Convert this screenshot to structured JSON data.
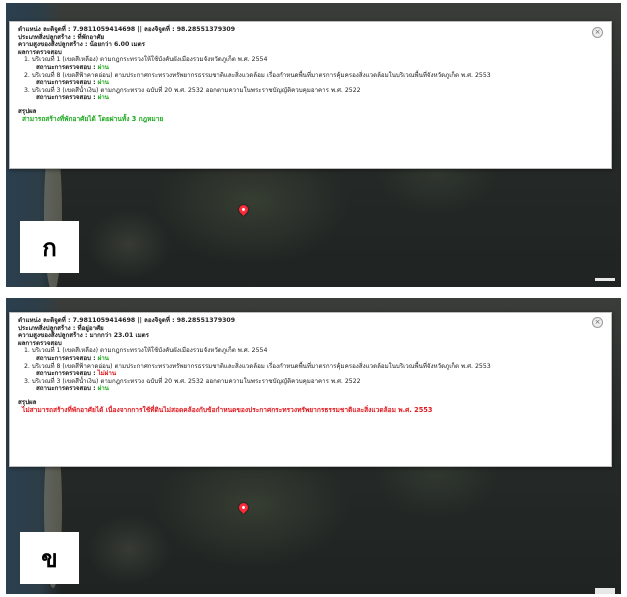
{
  "panels": [
    {
      "label": "ก",
      "location": {
        "lat_label": "ตำแหน่ง   ละติจูดที่ : 7.9811059414698  ||  ลองจิจูดที่ : 98.28551379309"
      },
      "building_type": "ประเภทสิ่งปลูกสร้าง : ที่พักอาศัย",
      "building_height": "ความสูงของสิ่งปลูกสร้าง : น้อยกว่า 6.00 เมตร",
      "results_heading": "ผลการตรวจสอบ",
      "checks": [
        {
          "text": "1. บริเวณที่ 1 (เขตสีเหลือง) ตามกฎกระทรวงให้ใช้บังคับผังเมืองรวมจังหวัดภูเก็ต พ.ศ. 2554",
          "status_label": "สถานะการตรวจสอบ :",
          "status": "ผ่าน"
        },
        {
          "text": "2. บริเวณที่ 8 (เขตสีฟ้าคาดอ่อน) ตามประกาศกระทรวงทรัพยากรธรรมชาติและสิ่งแวดล้อม เรื่องกำหนดพื้นที่มาตรการคุ้มครองสิ่งแวดล้อมในบริเวณพื้นที่จังหวัดภูเก็ต พ.ศ. 2553",
          "status_label": "สถานะการตรวจสอบ :",
          "status": "ผ่าน"
        },
        {
          "text": "3. บริเวณที่ 3 (เขตสีน้ำเงิน) ตามกฎกระทรวง ฉบับที่ 20 พ.ศ. 2532 ออกตามความในพระราชบัญญัติควบคุมอาคาร พ.ศ. 2522",
          "status_label": "สถานะการตรวจสอบ :",
          "status": "ผ่าน"
        }
      ],
      "summary_heading": "สรุปผล",
      "summary": "สามารถสร้างที่พักอาศัยได้ โดยผ่านทั้ง 3 กฎหมาย"
    },
    {
      "label": "ข",
      "location": {
        "lat_label": "ตำแหน่ง   ละติจูดที่ : 7.9811059414698  ||  ลองจิจูดที่ : 98.28551379309"
      },
      "building_type": "ประเภทสิ่งปลูกสร้าง : ที่อยู่อาศัย",
      "building_height": "ความสูงของสิ่งปลูกสร้าง : มากกว่า 23.01 เมตร",
      "results_heading": "ผลการตรวจสอบ",
      "checks": [
        {
          "text": "1. บริเวณที่ 1 (เขตสีเหลือง) ตามกฎกระทรวงให้ใช้บังคับผังเมืองรวมจังหวัดภูเก็ต พ.ศ. 2554",
          "status_label": "สถานะการตรวจสอบ :",
          "status": "ผ่าน"
        },
        {
          "text": "2. บริเวณที่ 8 (เขตสีฟ้าคาดอ่อน) ตามประกาศกระทรวงทรัพยากรธรรมชาติและสิ่งแวดล้อม เรื่องกำหนดพื้นที่มาตรการคุ้มครองสิ่งแวดล้อมในบริเวณพื้นที่จังหวัดภูเก็ต พ.ศ. 2553",
          "status_label": "สถานะการตรวจสอบ :",
          "status": "ไม่ผ่าน"
        },
        {
          "text": "3. บริเวณที่ 3 (เขตสีน้ำเงิน) ตามกฎกระทรวง ฉบับที่ 20 พ.ศ. 2532 ออกตามความในพระราชบัญญัติควบคุมอาคาร พ.ศ. 2522",
          "status_label": "สถานะการตรวจสอบ :",
          "status": "ผ่าน"
        }
      ],
      "summary_heading": "สรุปผล",
      "summary": "ไม่สามารถสร้างที่พักอาศัยได้ เนื่องจากการใช้ที่ดินไม่สอดคล้องกับข้อกำหนดของประกาศกระทรวงทรัพยากรธรรมชาติและสิ่งแวดล้อม พ.ศ. 2553"
    }
  ],
  "icons": {
    "close": "close-icon",
    "marker": "map-marker-icon"
  },
  "colors": {
    "pass": "#1fa81f",
    "fail": "#e0191f"
  }
}
